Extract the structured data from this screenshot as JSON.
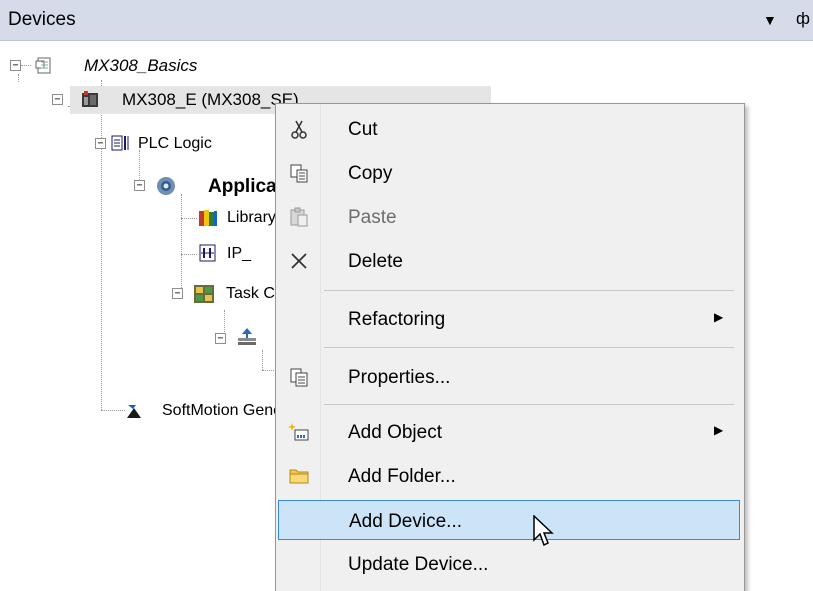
{
  "panel": {
    "title": "Devices",
    "dropdown_icon": "triangle-down",
    "pin_icon": "pin"
  },
  "tree": {
    "project": "MX308_Basics",
    "device": "MX308_E (MX308_SE)",
    "plc_logic": "PLC Logic",
    "application": "Application",
    "library": "Library Manager",
    "ip": "IP_",
    "task_config": "Task Configuration",
    "softmotion": "SoftMotion General Axis Pool",
    "expander_collapse": "−"
  },
  "menu": {
    "items": [
      {
        "label": "Cut",
        "icon": "scissors-icon",
        "enabled": true
      },
      {
        "label": "Copy",
        "icon": "copy-icon",
        "enabled": true
      },
      {
        "label": "Paste",
        "icon": "paste-icon",
        "enabled": false
      },
      {
        "label": "Delete",
        "icon": "delete-x-icon",
        "enabled": true
      },
      {
        "label": "Refactoring",
        "icon": "",
        "enabled": true,
        "submenu": true
      },
      {
        "label": "Properties...",
        "icon": "properties-icon",
        "enabled": true
      },
      {
        "label": "Add Object",
        "icon": "add-object-icon",
        "enabled": true,
        "submenu": true
      },
      {
        "label": "Add Folder...",
        "icon": "folder-icon",
        "enabled": true
      },
      {
        "label": "Add Device...",
        "icon": "",
        "enabled": true,
        "highlighted": true
      },
      {
        "label": "Update Device...",
        "icon": "",
        "enabled": true
      }
    ],
    "submenu_arrow": "▶"
  },
  "colors": {
    "header_bg": "#d6dbe9",
    "menu_bg": "#f0f0f0",
    "hover_bg": "#cce4f7",
    "hover_border": "#3a8ad6"
  }
}
